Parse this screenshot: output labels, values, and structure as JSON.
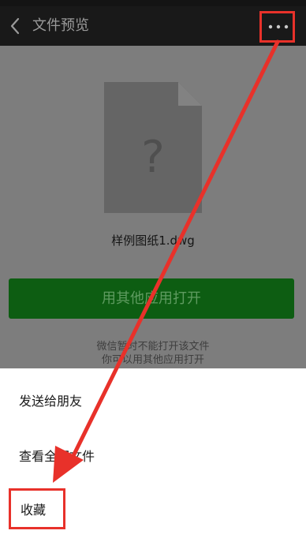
{
  "header": {
    "title": "文件预览"
  },
  "file": {
    "icon_glyph": "?",
    "name": "样例图纸1.dwg"
  },
  "open_button": {
    "label": "用其他应用打开"
  },
  "notice": {
    "line1": "微信暂时不能打开该文件",
    "line2": "你可以用其他应用打开"
  },
  "action_sheet": {
    "items": [
      {
        "label": "发送给朋友"
      },
      {
        "label": "查看全部文件"
      },
      {
        "label": "收藏"
      }
    ]
  },
  "colors": {
    "annotation": "#e8312a",
    "open_button_bg": "#0d5d12",
    "overlay": "#7d7d7d"
  },
  "icons": [
    "chevron-left-icon",
    "more-icon",
    "file-unknown-icon"
  ]
}
